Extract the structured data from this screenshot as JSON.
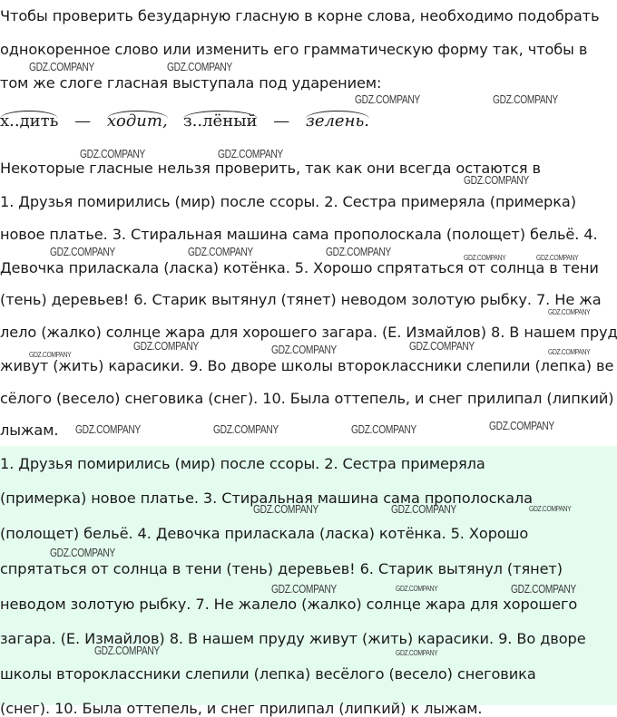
{
  "rule": {
    "lines": [
      "Чтобы проверить безударную гласную в корне слова, необходимо подобрать",
      "однокоренное слово или изменить его грамматическую форму так, чтобы в",
      "том же слоге гласная выступала под ударением:"
    ]
  },
  "example": {
    "w1": "х..дить",
    "w2": "ходит,",
    "w3": "з..лёный",
    "w4": "зелень.",
    "dash": "—"
  },
  "note": "Некоторые гласные нельзя проверить, так как они всегда остаются в",
  "task_lines": [
    "1. Друзья помирились (мир) после ссоры. 2. Сестра примеряла (примерка)",
    "новое платье. 3. Стиральная машина сама прополоскала (полощет) бельё. 4.",
    "Девочка приласкала (ласка) котёнка. 5. Хорошо спрятаться от солнца в тени",
    "(тень) деревьев! 6. Старик вытянул (тянет) неводом золотую рыбку. 7. Не жа",
    "лело (жалко) солнце жара для хорошего загара. (Е. Измайлов) 8. В нашем пруду",
    "живут (жить) карасики. 9. Во дворе школы второклассники слепили (лепка) ве",
    "сёлого (весело) снеговика (снег). 10. Была оттепель, и снег прилипал (липкий) к",
    "лыжам."
  ],
  "answer_lines": [
    "1. Друзья помирились (мир) после ссоры. 2. Сестра примеряла",
    "(примерка) новое платье. 3. Стиральная машина сама прополоскала",
    "(полощет) бельё. 4. Девочка приласкала (ласка) котёнка. 5. Хорошо",
    "спрятаться от солнца в тени (тень) деревьев! 6. Старик вытянул (тянет)",
    "неводом золотую рыбку. 7. Не жалело (жалко) солнце жара для хорошего",
    "загара. (Е. Измайлов) 8. В нашем пруду живут (жить) карасики. 9. Во дворе",
    "школы второклассники слепили (лепка) весёлого (весело) снеговика",
    "(снег). 10. Была оттепель, и снег прилипал (липкий) к лыжам."
  ],
  "watermark": "GDZ.COMPANY"
}
